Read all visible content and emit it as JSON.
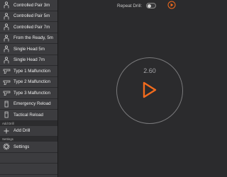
{
  "sidebar": {
    "drills": [
      {
        "label": "Controlled Pair 3m",
        "icon": "target-figure-icon"
      },
      {
        "label": "Controlled Pair 5m",
        "icon": "target-figure-icon"
      },
      {
        "label": "Controlled Pair 7m",
        "icon": "target-figure-icon"
      },
      {
        "label": "From the Ready, 5m",
        "icon": "target-figure-icon"
      },
      {
        "label": "Single Head 5m",
        "icon": "target-figure-icon"
      },
      {
        "label": "Single Head 7m",
        "icon": "target-figure-icon"
      },
      {
        "label": "Type 1 Malfunction",
        "icon": "pistol-icon"
      },
      {
        "label": "Type 2 Malfunction",
        "icon": "pistol-icon"
      },
      {
        "label": "Type 3 Malfunction",
        "icon": "pistol-icon"
      },
      {
        "label": "Emergency Reload",
        "icon": "magazine-icon"
      },
      {
        "label": "Tactical Reload",
        "icon": "magazine-icon"
      }
    ],
    "add_drill_section": "Add Drill",
    "add_drill_label": "Add Drill",
    "settings_section": "Settings",
    "settings_label": "Settings"
  },
  "header": {
    "repeat_label": "Repeat Drill:",
    "repeat_on": false
  },
  "timer": {
    "time": "2.60"
  },
  "colors": {
    "accent": "#f26b1d",
    "background": "#2b2b2d",
    "sidebar": "#3a3a3d"
  }
}
